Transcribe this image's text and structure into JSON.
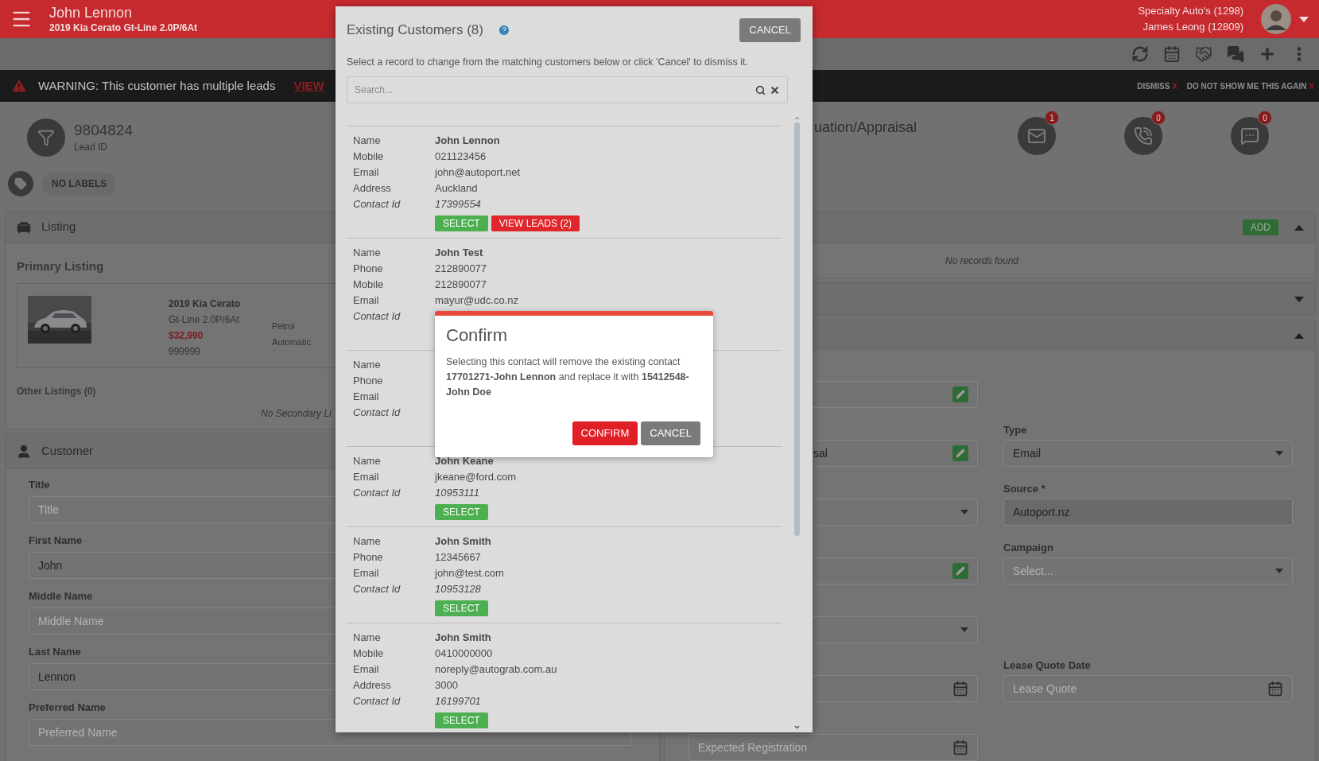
{
  "app_bar": {
    "title": "John Lennon",
    "subtitle": "2019 Kia Cerato Gt-Line 2.0P/6At",
    "dealer": "Specialty Auto's (1298)",
    "user": "James Leong (12809)"
  },
  "warning": {
    "text": "WARNING: This customer has multiple leads",
    "link": "VIEW",
    "actions": [
      {
        "label": "DISMISS",
        "mark": "X"
      },
      {
        "label": "DO NOT SHOW ME THIS AGAIN",
        "mark": "X"
      }
    ]
  },
  "lead": {
    "id": "9804824",
    "id_label": "Lead ID",
    "labels_button": "NO LABELS"
  },
  "listing": {
    "title": "Listing",
    "primary_title": "Primary Listing",
    "vehicle": {
      "title": "2019 Kia Cerato",
      "variant": "Gt-Line 2.0P/6At",
      "price": "$32,990",
      "stock": "999999",
      "fuel": "Petrol",
      "transmission": "Automatic"
    },
    "other_title": "Other Listings (0)",
    "other_empty": "No Secondary Li"
  },
  "customer": {
    "title": "Customer",
    "fields": [
      {
        "label": "Title",
        "placeholder": "Title"
      },
      {
        "label": "First Name",
        "value": "John"
      },
      {
        "label": "Middle Name",
        "placeholder": "Middle Name"
      },
      {
        "label": "Last Name",
        "value": "Lennon"
      },
      {
        "label": "Preferred Name",
        "placeholder": "Preferred Name"
      }
    ]
  },
  "right": {
    "heading": "uation/Appraisal",
    "counters": [
      {
        "kind": "email",
        "count": "1"
      },
      {
        "kind": "phone",
        "count": "0"
      },
      {
        "kind": "chat",
        "count": "0"
      }
    ],
    "sections": [
      {
        "expanded": true,
        "button": "ADD",
        "empty": "No records found"
      },
      {
        "expanded": false
      },
      {
        "expanded": true
      }
    ],
    "rows": [
      {
        "left": {
          "kind": "edit"
        }
      },
      {
        "left": {
          "kind": "edit",
          "value": "sal"
        },
        "right": {
          "kind": "select",
          "label": "Type",
          "value": "Email"
        }
      },
      {
        "left": {
          "kind": "select"
        },
        "right": {
          "kind": "readonly",
          "label": "Source *",
          "value": "Autoport.nz"
        }
      },
      {
        "left": {
          "kind": "edit"
        },
        "right": {
          "kind": "select",
          "label": "Campaign",
          "placeholder": "Select..."
        }
      },
      {
        "left": {
          "kind": "select"
        }
      },
      {
        "left": {
          "kind": "date"
        },
        "right": {
          "kind": "date",
          "label": "Lease Quote Date",
          "placeholder": "Lease Quote"
        }
      },
      {
        "left": {
          "kind": "date",
          "placeholder": "Expected Registration"
        }
      }
    ]
  },
  "modal": {
    "title": "Existing Customers (8)",
    "cancel": "CANCEL",
    "instructions": "Select a record to change from the matching customers below or click 'Cancel' to dismiss it.",
    "search_placeholder": "Search...",
    "records": [
      {
        "fields": [
          {
            "kind": "name",
            "label": "Name",
            "value": "John Lennon"
          },
          {
            "kind": "plain",
            "label": "Mobile",
            "value": "021123456"
          },
          {
            "kind": "plain",
            "label": "Email",
            "value": "john@autoport.net"
          },
          {
            "kind": "plain",
            "label": "Address",
            "value": "Auckland"
          },
          {
            "kind": "id",
            "label": "Contact Id",
            "value": "17399554"
          }
        ],
        "buttons": [
          {
            "kind": "select",
            "label": "SELECT"
          },
          {
            "kind": "leads",
            "label": "VIEW LEADS (2)"
          }
        ]
      },
      {
        "fields": [
          {
            "kind": "name",
            "label": "Name",
            "value": "John Test"
          },
          {
            "kind": "plain",
            "label": "Phone",
            "value": "212890077"
          },
          {
            "kind": "plain",
            "label": "Mobile",
            "value": "212890077"
          },
          {
            "kind": "plain",
            "label": "Email",
            "value": "mayur@udc.co.nz"
          },
          {
            "kind": "id",
            "label": "Contact Id"
          }
        ]
      },
      {
        "fields": [
          {
            "kind": "name",
            "label": "Name"
          },
          {
            "kind": "plain",
            "label": "Phone"
          },
          {
            "kind": "plain",
            "label": "Email"
          },
          {
            "kind": "id",
            "label": "Contact Id"
          }
        ]
      },
      {
        "fields": [
          {
            "kind": "name",
            "label": "Name",
            "value": "John Keane"
          },
          {
            "kind": "plain",
            "label": "Email",
            "value": "jkeane@ford.com"
          },
          {
            "kind": "id",
            "label": "Contact Id",
            "value": "10953111"
          }
        ],
        "buttons": [
          {
            "kind": "select",
            "label": "SELECT"
          }
        ]
      },
      {
        "fields": [
          {
            "kind": "name",
            "label": "Name",
            "value": "John Smith"
          },
          {
            "kind": "plain",
            "label": "Phone",
            "value": "12345667"
          },
          {
            "kind": "plain",
            "label": "Email",
            "value": "john@test.com"
          },
          {
            "kind": "id",
            "label": "Contact Id",
            "value": "10953128"
          }
        ],
        "buttons": [
          {
            "kind": "select",
            "label": "SELECT"
          }
        ]
      },
      {
        "fields": [
          {
            "kind": "name",
            "label": "Name",
            "value": "John Smith"
          },
          {
            "kind": "plain",
            "label": "Mobile",
            "value": "0410000000"
          },
          {
            "kind": "plain",
            "label": "Email",
            "value": "noreply@autograb.com.au"
          },
          {
            "kind": "plain",
            "label": "Address",
            "value": "3000"
          },
          {
            "kind": "id",
            "label": "Contact Id",
            "value": "16199701"
          }
        ],
        "buttons": [
          {
            "kind": "select",
            "label": "SELECT"
          }
        ]
      }
    ]
  },
  "confirm": {
    "title": "Confirm",
    "message": "Selecting this contact will remove the existing contact **17701271-John Lennon** and replace it with **15412548-John Doe**",
    "buttons": [
      {
        "kind": "primary",
        "label": "CONFIRM"
      },
      {
        "kind": "secondary",
        "label": "CANCEL"
      }
    ]
  }
}
